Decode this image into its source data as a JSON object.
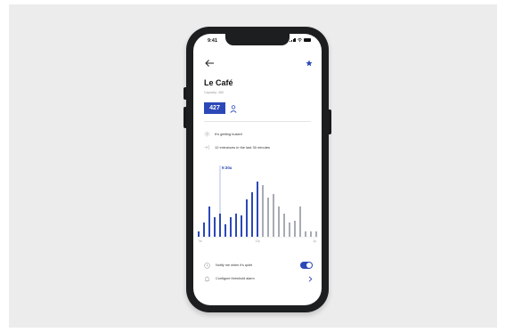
{
  "status_bar": {
    "time": "9:41"
  },
  "header": {
    "back_icon": "arrow-left-icon",
    "favorite_icon": "star-icon"
  },
  "venue": {
    "name": "Le Café",
    "capacity_text": "Capacity: 480",
    "current_count": "427"
  },
  "insights": [
    {
      "icon": "sparkle-icon",
      "text": "It's getting busier!"
    },
    {
      "icon": "entrance-arrows-icon",
      "text": "12 entrances in the last 30 minutes"
    }
  ],
  "chart_data": {
    "type": "bar",
    "current_marker_label": "9:30a",
    "x_tick_labels": [
      "9a",
      "12p",
      "3p"
    ],
    "values": [
      6,
      16,
      34,
      22,
      26,
      14,
      22,
      26,
      24,
      42,
      50,
      62,
      58,
      44,
      48,
      34,
      26,
      16,
      18,
      34,
      6,
      6,
      6
    ],
    "current_index": 4,
    "ylim": [
      0,
      70
    ],
    "past_color": "#2c48b8",
    "future_color": "#a7abb3",
    "marker_color": "#8f9fd8"
  },
  "settings": {
    "notify_label": "Notify me when it's quiet",
    "notify_enabled": true,
    "threshold_label": "Configure threshold alarm"
  },
  "colors": {
    "accent": "#2c48b8",
    "background": "#ececec",
    "phone": "#1d1e20"
  }
}
